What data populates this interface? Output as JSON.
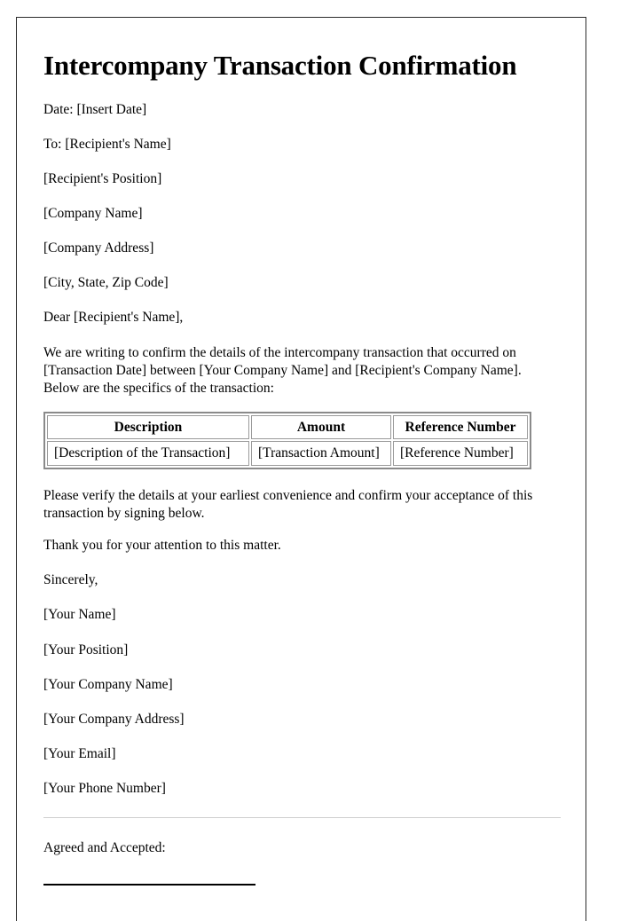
{
  "document": {
    "title": "Intercompany Transaction Confirmation",
    "date_line": "Date: [Insert Date]",
    "recipient": {
      "to_line": "To: [Recipient's Name]",
      "position": "[Recipient's Position]",
      "company_name": "[Company Name]",
      "company_address": "[Company Address]",
      "city_state_zip": "[City, State, Zip Code]"
    },
    "salutation": "Dear [Recipient's Name],",
    "intro_paragraph": "We are writing to confirm the details of the intercompany transaction that occurred on [Transaction Date] between [Your Company Name] and [Recipient's Company Name]. Below are the specifics of the transaction:",
    "table": {
      "headers": [
        "Description",
        "Amount",
        "Reference Number"
      ],
      "rows": [
        [
          "[Description of the Transaction]",
          "[Transaction Amount]",
          "[Reference Number]"
        ]
      ]
    },
    "verify_paragraph": "Please verify the details at your earliest convenience and confirm your acceptance of this transaction by signing below.",
    "thanks_paragraph": "Thank you for your attention to this matter.",
    "closing": "Sincerely,",
    "sender": {
      "name": "[Your Name]",
      "position": "[Your Position]",
      "company_name": "[Your Company Name]",
      "company_address": "[Your Company Address]",
      "email": "[Your Email]",
      "phone": "[Your Phone Number]"
    },
    "agreement_heading": "Agreed and Accepted:"
  }
}
